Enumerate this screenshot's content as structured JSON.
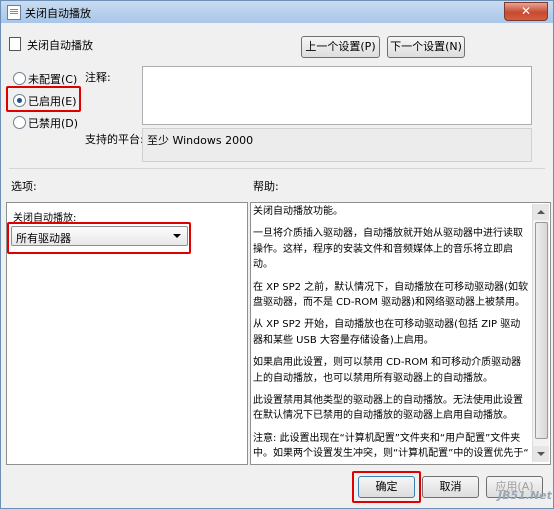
{
  "window": {
    "title": "关闭自动播放",
    "close_glyph": "✕"
  },
  "header": {
    "title": "关闭自动播放",
    "prev_button": "上一个设置(P)",
    "next_button": "下一个设置(N)"
  },
  "state": {
    "options": [
      {
        "label": "未配置(C)",
        "selected": false
      },
      {
        "label": "已启用(E)",
        "selected": true
      },
      {
        "label": "已禁用(D)",
        "selected": false
      }
    ]
  },
  "comment": {
    "label": "注释:",
    "value": ""
  },
  "platform": {
    "label": "支持的平台:",
    "value": "至少 Windows 2000"
  },
  "options_section": {
    "label": "选项:",
    "dropdown_label": "关闭自动播放:",
    "dropdown_value": "所有驱动器"
  },
  "help_section": {
    "label": "帮助:",
    "paragraphs": [
      "关闭自动播放功能。",
      "一旦将介质插入驱动器，自动播放就开始从驱动器中进行读取操作。这样，程序的安装文件和音频媒体上的音乐将立即启动。",
      "在 XP SP2 之前，默认情况下，自动播放在可移动驱动器(如软盘驱动器，而不是 CD-ROM 驱动器)和网络驱动器上被禁用。",
      "从 XP SP2 开始，自动播放也在可移动驱动器(包括 ZIP 驱动器和某些 USB 大容量存储设备)上启用。",
      "如果启用此设置，则可以禁用 CD-ROM 和可移动介质驱动器上的自动播放，也可以禁用所有驱动器上的自动播放。",
      "此设置禁用其他类型的驱动器上的自动播放。无法使用此设置在默认情况下已禁用的自动播放的驱动器上启用自动播放。",
      "注意: 此设置出现在“计算机配置”文件夹和“用户配置”文件夹中。如果两个设置发生冲突，则“计算机配置”中的设置优先于“"
    ]
  },
  "footer": {
    "ok": "确定",
    "cancel": "取消",
    "apply": "应用(A)"
  },
  "watermark": "JB51.Net"
}
